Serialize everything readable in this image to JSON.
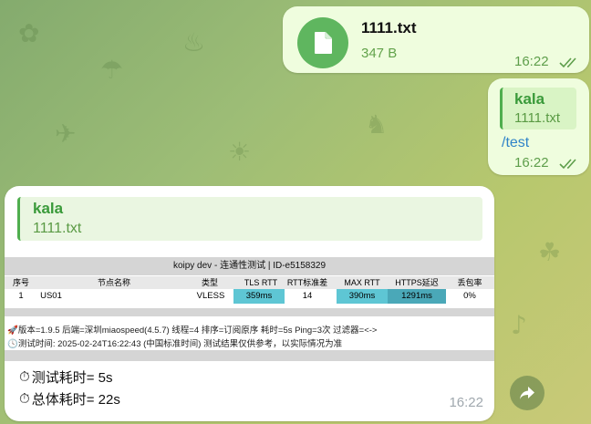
{
  "file_message": {
    "file_name": "1111.txt",
    "file_size": "347 B",
    "time": "16:22",
    "icon": "file-icon"
  },
  "reply_message": {
    "quote_author": "kala",
    "quote_text": "1111.txt",
    "text": "/test",
    "time": "16:22"
  },
  "bot_message": {
    "quote_author": "kala",
    "quote_text": "1111.txt",
    "image": {
      "title": "koipy dev - 连通性测试 | ID-e5158329",
      "watermark": "koipy dev",
      "headers": [
        "序号",
        "节点名称",
        "类型",
        "TLS RTT",
        "RTT标准差",
        "MAX RTT",
        "HTTPS延迟",
        "丢包率"
      ],
      "rows": [
        [
          "1",
          "US01",
          "VLESS",
          "359ms",
          "14",
          "390ms",
          "1291ms",
          "0%"
        ]
      ],
      "info_line1": "版本=1.9.5  后端=深圳miaospeed(4.5.7)  线程=4  排序=订阅原序  耗时=5s  Ping=3次  过滤器=<->",
      "info_line2": "测试时间: 2025-02-24T16:22:43 (中国标准时间) 测试结果仅供参考，以实际情况为准"
    },
    "result_test_time": "测试耗时= 5s",
    "result_total_time": "总体耗时= 22s",
    "time": "16:22"
  },
  "colors": {
    "outgoing_bubble": "#effdde",
    "accent_green": "#4fae4e",
    "link_blue": "#2f83c8",
    "cell_cyan": "#5ec6d4"
  }
}
